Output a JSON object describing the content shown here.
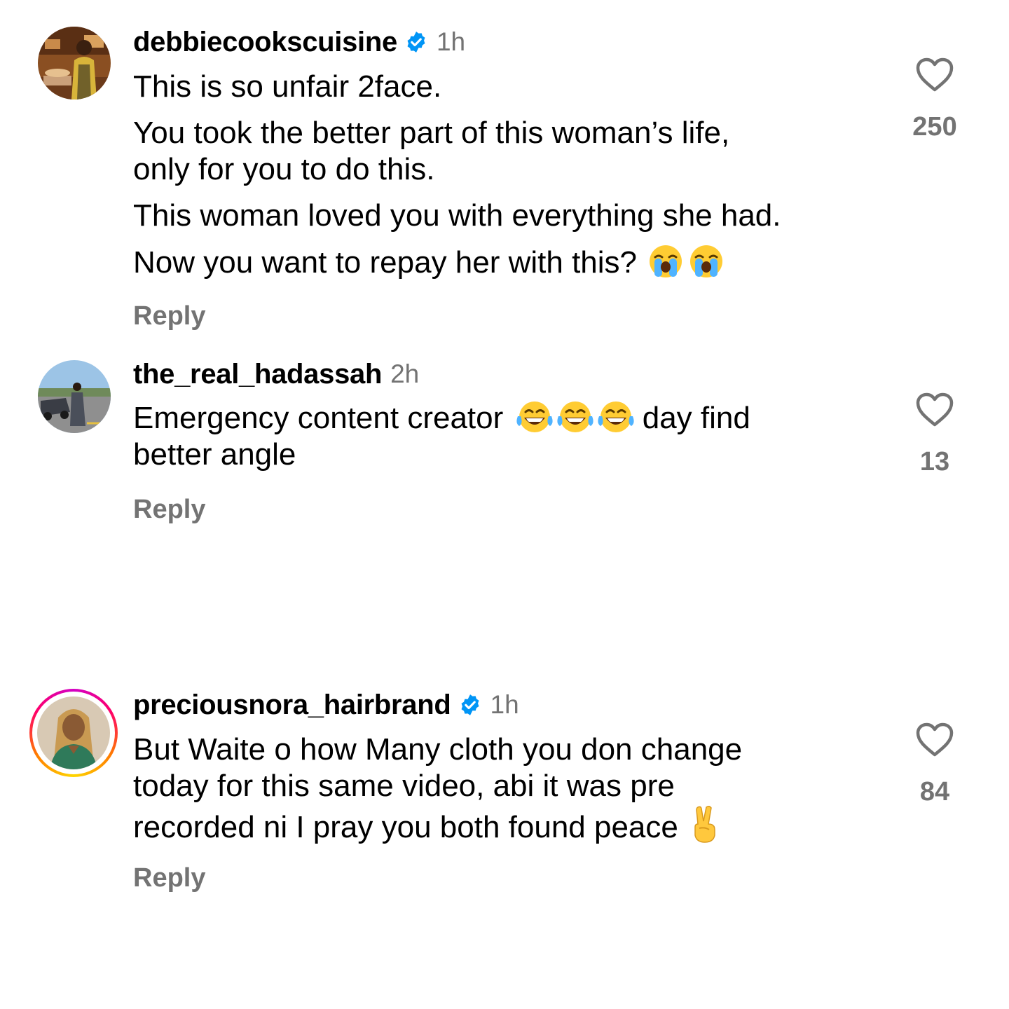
{
  "comments": [
    {
      "username": "debbiecookscuisine",
      "verified": true,
      "time": "1h",
      "lines": [
        "This is so unfair 2face.",
        "You took the better part of this woman’s life,",
        "only for you to do this.",
        "This woman loved you with everything she had.",
        "Now you want to repay her with this?"
      ],
      "emojis": [
        "loudly-crying-face",
        "loudly-crying-face"
      ],
      "reply_label": "Reply",
      "likes": "250"
    },
    {
      "username": "the_real_hadassah",
      "verified": false,
      "time": "2h",
      "text_before_emojis": "Emergency content creator",
      "emojis": [
        "face-with-tears-of-joy",
        "face-with-tears-of-joy",
        "face-with-tears-of-joy"
      ],
      "text_after_emojis": "day find",
      "text_line2": "better angle",
      "reply_label": "Reply",
      "likes": "13"
    },
    {
      "username": "preciousnora_hairbrand",
      "verified": true,
      "has_story_ring": true,
      "time": "1h",
      "lines": [
        "But Waite o how Many cloth you don change",
        "today for this same video, abi it was pre",
        "recorded ni I pray you both found peace"
      ],
      "emojis": [
        "victory-hand"
      ],
      "reply_label": "Reply",
      "likes": "84"
    }
  ],
  "colors": {
    "text": "#000000",
    "secondary": "#737373",
    "verified_blue": "#0095f6"
  },
  "icons": {
    "like": "heart-outline-icon",
    "verified": "verified-badge-icon"
  }
}
